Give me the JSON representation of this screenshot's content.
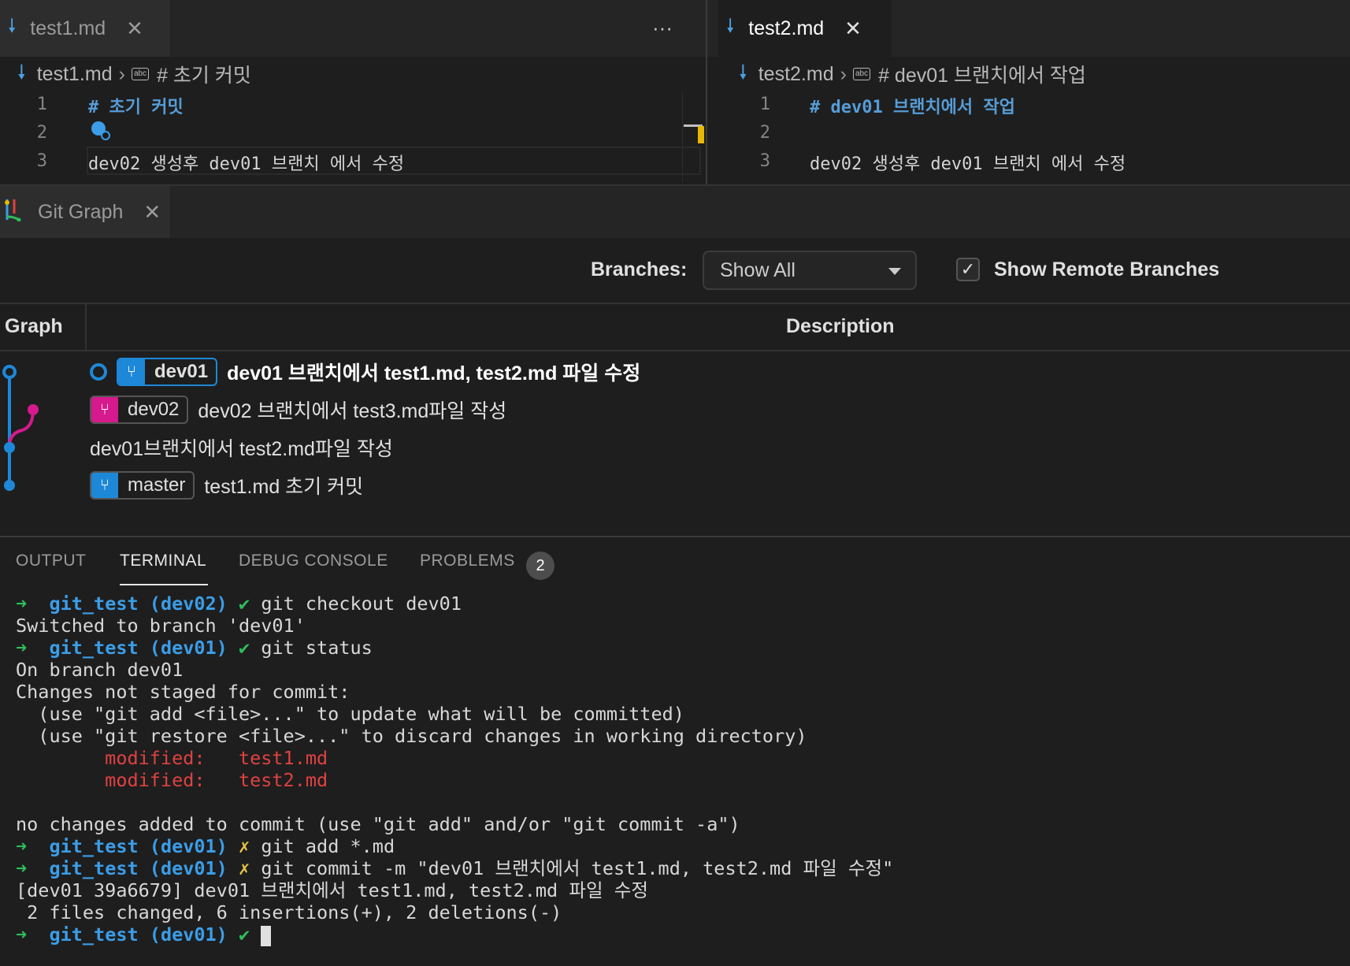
{
  "editor_left": {
    "tab_title": "test1.md",
    "more_actions": "···",
    "breadcrumb": {
      "file": "test1.md",
      "symbol": "# 초기 커밋"
    },
    "lines": [
      {
        "num": "1",
        "text": "# 초기 커밋"
      },
      {
        "num": "2",
        "text": ""
      },
      {
        "num": "3",
        "text": "dev02 생성후 dev01 브랜치 에서 수정"
      }
    ]
  },
  "editor_right": {
    "tab_title": "test2.md",
    "breadcrumb": {
      "file": "test2.md",
      "symbol": "# dev01 브랜치에서 작업"
    },
    "lines": [
      {
        "num": "1",
        "text": "# dev01 브랜치에서 작업"
      },
      {
        "num": "2",
        "text": ""
      },
      {
        "num": "3",
        "text": "dev02 생성후 dev01 브랜치 에서 수정"
      }
    ]
  },
  "git_graph": {
    "tab_title": "Git Graph",
    "branches_label": "Branches:",
    "branches_value": "Show All",
    "show_remote_label": "Show Remote Branches",
    "show_remote_checked": true,
    "col_graph": "Graph",
    "col_description": "Description",
    "commits": [
      {
        "ref": "dev01",
        "ref_color": "#1e88d8",
        "message": "dev01 브랜치에서 test1.md, test2.md 파일 수정",
        "current": true
      },
      {
        "ref": "dev02",
        "ref_color": "#d6198c",
        "message": "dev02 브랜치에서 test3.md파일 작성"
      },
      {
        "ref": "",
        "message": "dev01브랜치에서 test2.md파일 작성"
      },
      {
        "ref": "master",
        "ref_color": "#1e88d8",
        "message": "test1.md 초기 커밋"
      }
    ]
  },
  "panel": {
    "tabs": [
      "OUTPUT",
      "TERMINAL",
      "DEBUG CONSOLE",
      "PROBLEMS"
    ],
    "active_tab": "TERMINAL",
    "problems_count": "2",
    "terminal": [
      {
        "arrow": "➜",
        "dir": "git_test",
        "branch": "(dev02)",
        "mark": "✔",
        "cmd": "git checkout dev01"
      },
      {
        "out": "Switched to branch 'dev01'"
      },
      {
        "arrow": "➜",
        "dir": "git_test",
        "branch": "(dev01)",
        "mark": "✔",
        "cmd": "git status"
      },
      {
        "out": "On branch dev01"
      },
      {
        "out": "Changes not staged for commit:"
      },
      {
        "out": "  (use \"git add <file>...\" to update what will be committed)"
      },
      {
        "out": "  (use \"git restore <file>...\" to discard changes in working directory)"
      },
      {
        "mod_label": "        modified:   ",
        "mod_file": "test1.md"
      },
      {
        "mod_label": "        modified:   ",
        "mod_file": "test2.md"
      },
      {
        "out": ""
      },
      {
        "out": "no changes added to commit (use \"git add\" and/or \"git commit -a\")"
      },
      {
        "arrow": "➜",
        "dir": "git_test",
        "branch": "(dev01)",
        "mark": "✗",
        "cmd": "git add *.md"
      },
      {
        "arrow": "➜",
        "dir": "git_test",
        "branch": "(dev01)",
        "mark": "✗",
        "cmd": "git commit -m \"dev01 브랜치에서 test1.md, test2.md 파일 수정\""
      },
      {
        "out": "[dev01 39a6679] dev01 브랜치에서 test1.md, test2.md 파일 수정"
      },
      {
        "out": " 2 files changed, 6 insertions(+), 2 deletions(-)"
      },
      {
        "arrow": "➜",
        "dir": "git_test",
        "branch": "(dev01)",
        "mark": "✔",
        "cmd": "",
        "cursor": true
      }
    ]
  }
}
